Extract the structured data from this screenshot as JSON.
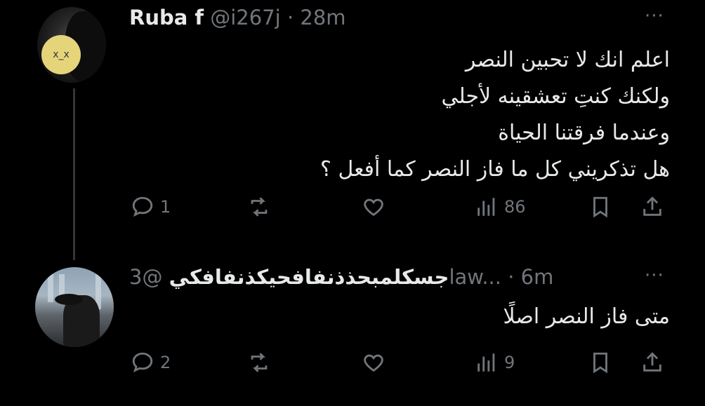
{
  "tweets": [
    {
      "author_name": "Ruba f",
      "handle": "@i267j",
      "separator": "·",
      "time": "28m",
      "more_label": "···",
      "lines": [
        "اعلم انك لا تحبين النصر",
        "ولكنك كنتِ تعشقينه لأجلي",
        "وعندما فرقتنا الحياة",
        "هل تذكريني كل ما فاز النصر كما أفعل ؟"
      ],
      "avatar_text": "x_x",
      "actions": {
        "replies": "1",
        "reposts": "",
        "likes": "",
        "views": "86"
      }
    },
    {
      "author_name": "جسكلمبحذذنفافحيكذنفافكي",
      "handle": "@3law...",
      "separator": "·",
      "time": "6m",
      "more_label": "···",
      "lines": [
        "متى فاز النصر اصلًا"
      ],
      "actions": {
        "replies": "2",
        "reposts": "",
        "likes": "",
        "views": "9"
      }
    }
  ],
  "icons": {
    "reply": "reply-icon",
    "repost": "repost-icon",
    "like": "heart-icon",
    "views": "views-icon",
    "bookmark": "bookmark-icon",
    "share": "share-icon"
  },
  "colors": {
    "background": "#000000",
    "text": "#e7e9ea",
    "muted": "#71767b"
  }
}
